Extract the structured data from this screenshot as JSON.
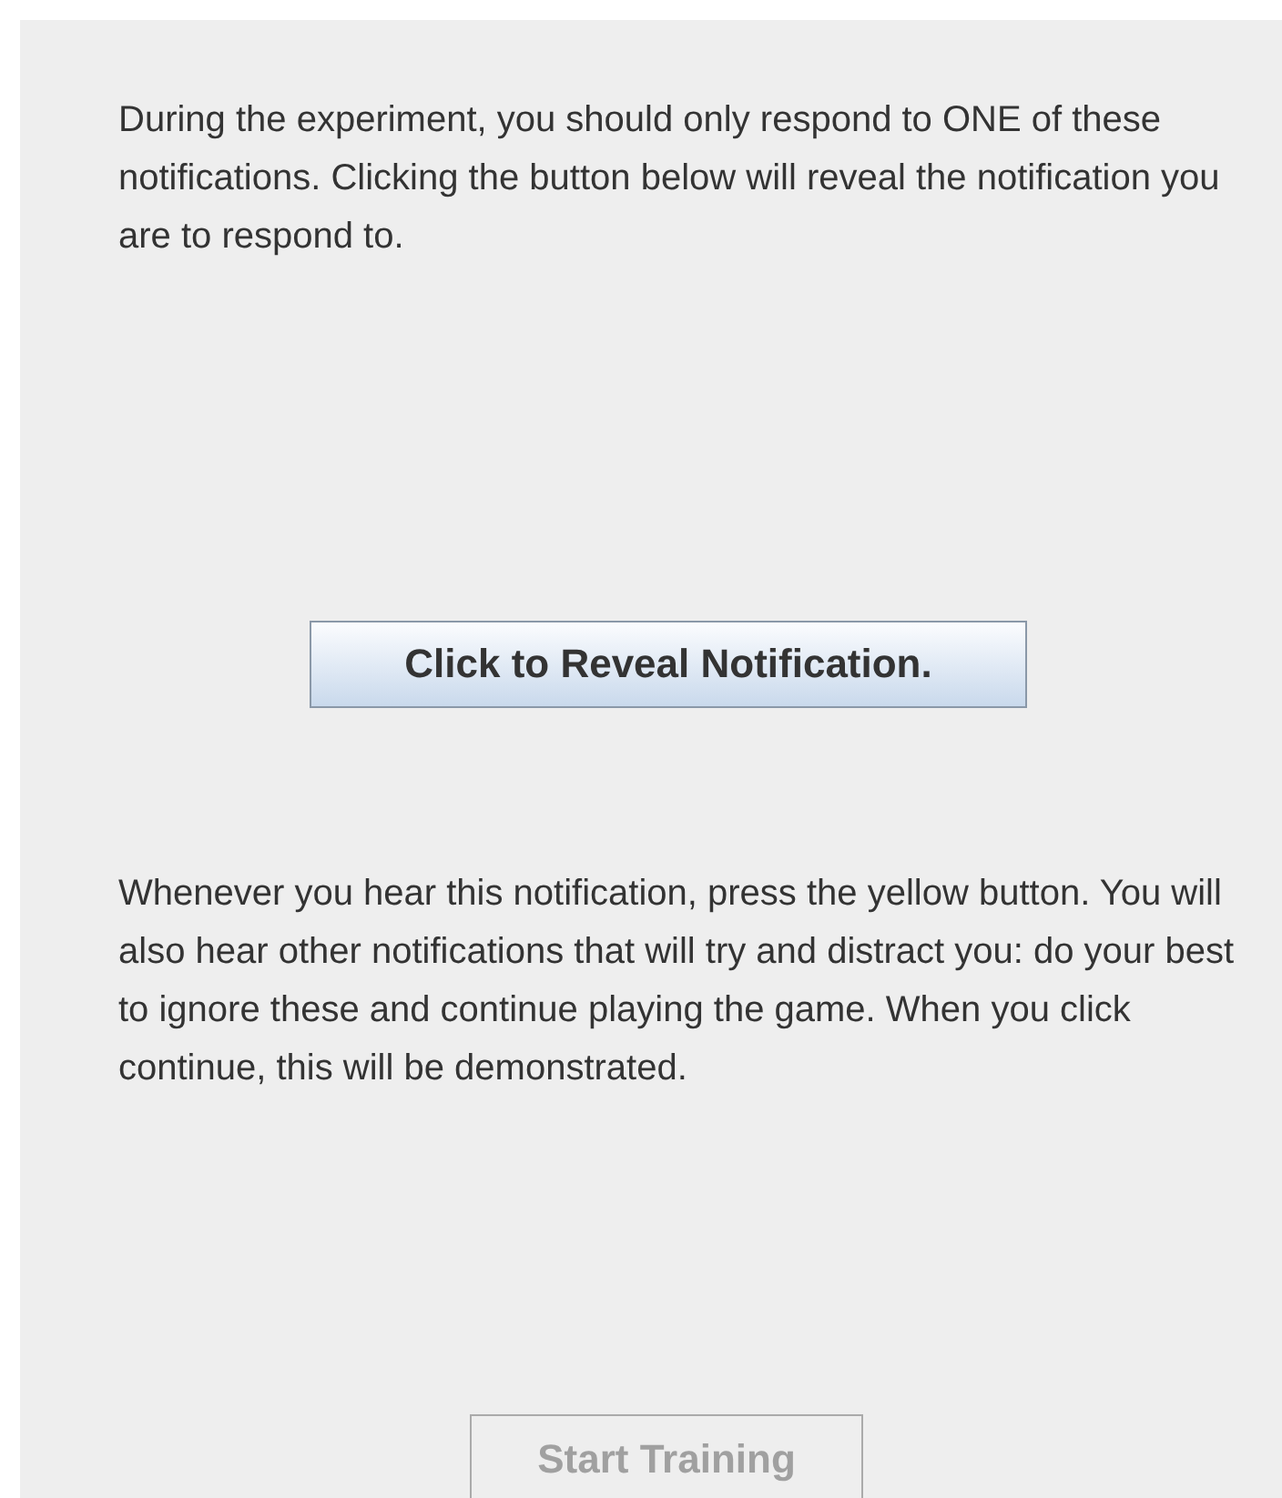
{
  "intro": "During the experiment, you should only respond to ONE of these notifications. Clicking the button below will reveal the notification you are to respond to.",
  "reveal_button": {
    "label": "Click to Reveal Notification.",
    "disabled": false
  },
  "instructions": "Whenever you hear this notification, press the yellow button. You will also hear other notifications that will try and distract you: do your best to ignore these and continue playing the game. When you click continue, this will be demonstrated.",
  "start_button": {
    "label": "Start Training",
    "disabled": true
  }
}
